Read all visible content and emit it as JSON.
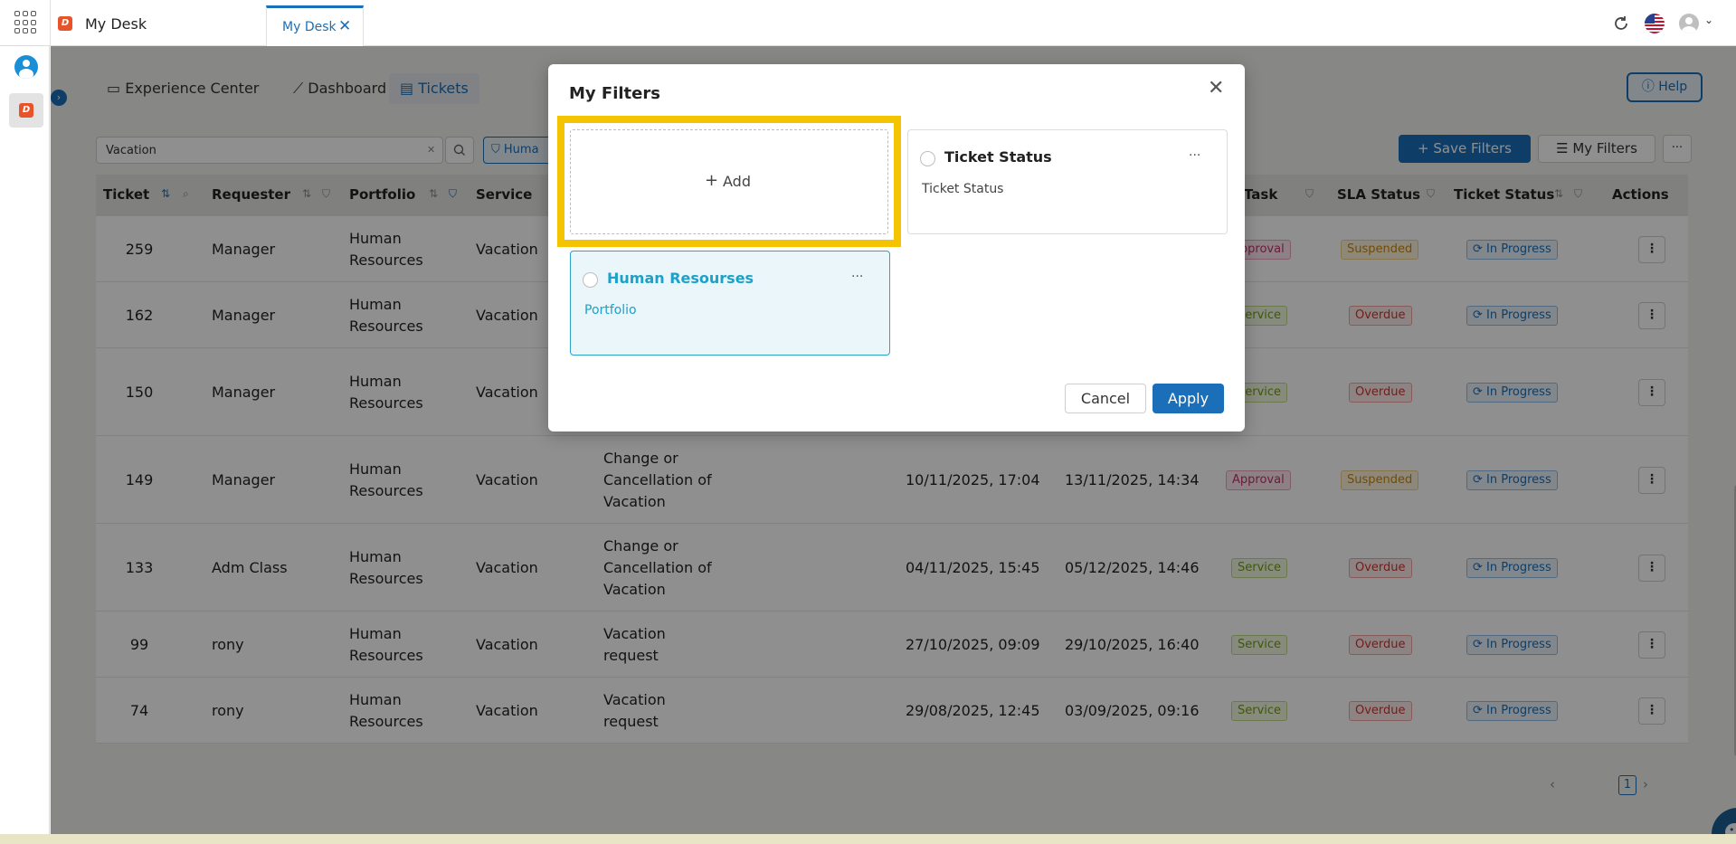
{
  "topbar": {
    "app_title": "My Desk",
    "active_tab": "My Desk",
    "app_mark": "D"
  },
  "nav": {
    "tabs": [
      "Experience Center",
      "Dashboard",
      "Tickets"
    ],
    "help": "Help"
  },
  "toolbar": {
    "search_value": "Vacation",
    "filter_chip": "Huma",
    "save_filters": "Save Filters",
    "my_filters": "My Filters",
    "more": "···"
  },
  "table": {
    "headers": [
      "Ticket",
      "Requester",
      "Portfolio",
      "Service",
      "Task",
      "SLA Status",
      "Ticket Status",
      "Actions"
    ],
    "rows": [
      {
        "ticket": "259",
        "requester": "Manager",
        "portfolio": [
          "Human",
          "Resources"
        ],
        "service": "Vacation",
        "request": [],
        "opened": "",
        "due": "",
        "task": "Approval",
        "sla": "Suspended",
        "status": "In Progress"
      },
      {
        "ticket": "162",
        "requester": "Manager",
        "portfolio": [
          "Human",
          "Resources"
        ],
        "service": "Vacation",
        "request": [],
        "opened": "",
        "due": "",
        "task": "Service",
        "sla": "Overdue",
        "status": "In Progress"
      },
      {
        "ticket": "150",
        "requester": "Manager",
        "portfolio": [
          "Human",
          "Resources"
        ],
        "service": "Vacation",
        "request": [],
        "opened": "",
        "due": "",
        "task": "Service",
        "sla": "Overdue",
        "status": "In Progress"
      },
      {
        "ticket": "149",
        "requester": "Manager",
        "portfolio": [
          "Human",
          "Resources"
        ],
        "service": "Vacation",
        "request": [
          "Change or",
          "Cancellation of",
          "Vacation"
        ],
        "opened": "10/11/2025, 17:04",
        "due": "13/11/2025, 14:34",
        "task": "Approval",
        "sla": "Suspended",
        "status": "In Progress"
      },
      {
        "ticket": "133",
        "requester": "Adm Class",
        "portfolio": [
          "Human",
          "Resources"
        ],
        "service": "Vacation",
        "request": [
          "Change or",
          "Cancellation of",
          "Vacation"
        ],
        "opened": "04/11/2025, 15:45",
        "due": "05/12/2025, 14:46",
        "task": "Service",
        "sla": "Overdue",
        "status": "In Progress"
      },
      {
        "ticket": "99",
        "requester": "rony",
        "portfolio": [
          "Human",
          "Resources"
        ],
        "service": "Vacation",
        "request": [
          "Vacation",
          "request"
        ],
        "opened": "27/10/2025, 09:09",
        "due": "29/10/2025, 16:40",
        "task": "Service",
        "sla": "Overdue",
        "status": "In Progress"
      },
      {
        "ticket": "74",
        "requester": "rony",
        "portfolio": [
          "Human",
          "Resources"
        ],
        "service": "Vacation",
        "request": [
          "Vacation",
          "request"
        ],
        "opened": "29/08/2025, 12:45",
        "due": "03/09/2025, 09:16",
        "task": "Service",
        "sla": "Overdue",
        "status": "In Progress"
      }
    ]
  },
  "pagination": {
    "page": "1"
  },
  "modal": {
    "title": "My Filters",
    "add_label": "Add",
    "filters": [
      {
        "name": "Ticket Status",
        "sub": "Ticket Status",
        "selected": false
      },
      {
        "name": "Human Resourses",
        "sub": "Portfolio",
        "selected": true
      }
    ],
    "cancel": "Cancel",
    "apply": "Apply"
  },
  "colors": {
    "primary": "#1a6fb8",
    "highlight": "#f5c400",
    "selected_accent": "#1da1c9",
    "brand_orange": "#e8542a"
  }
}
